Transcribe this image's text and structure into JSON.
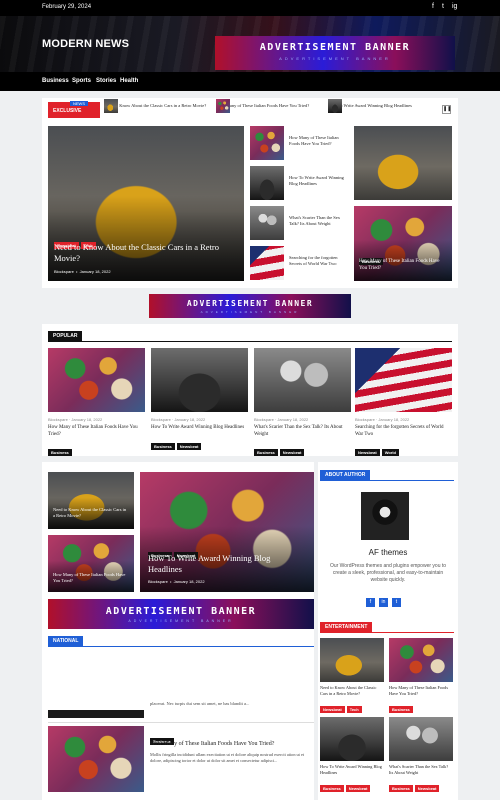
{
  "topbar": {
    "date": "February 29, 2024",
    "social": [
      "f",
      "t",
      "ig"
    ]
  },
  "header": {
    "logo": "MODERN NEWS",
    "ad_title": "ADVERTISEMENT BANNER",
    "ad_sub": "ADVERTISEMENT BANNER"
  },
  "nav": [
    "Business",
    "Sports",
    "Stories",
    "Health"
  ],
  "ticker": {
    "badge_top": "NEWS",
    "badge": "EXCLUSIVE",
    "items": [
      "Need to Know About the Classic Cars in a Retro Movie?",
      "How Many of These Italian Foods Have You Tried?",
      "How To Write Award Winning Blog Headlines"
    ]
  },
  "featured": {
    "tags": [
      "Newsbeat",
      "Tech"
    ],
    "title": "Need to Know About the Classic Cars in a Retro Movie?",
    "author": "Blockspare",
    "date": "January 18, 2022"
  },
  "side_list": [
    "How Many of These Italian Foods Have You Tried?",
    "How To Write Award Winning Blog Headlines",
    "What's Scarier Than the Sex Talk? Its About Weight",
    "Searching for the forgotten Secrets of World War Two"
  ],
  "right_card": {
    "tag": "Business",
    "title": "How Many of These Italian Foods Have You Tried?"
  },
  "ad_mid": {
    "title": "ADVERTISEMENT BANNER",
    "sub": "ADVERTISEMENT BANNER"
  },
  "popular": {
    "title": "POPULAR",
    "cards": [
      {
        "author": "Blockspare",
        "date": "January 18, 2022",
        "title": "How Many of These Italian Foods Have You Tried?",
        "tags": [
          "Business"
        ]
      },
      {
        "author": "Blockspare",
        "date": "January 18, 2022",
        "title": "How To Write Award Winning Blog Headlines",
        "tags": [
          "Business",
          "Newsbeat"
        ]
      },
      {
        "author": "Blockspare",
        "date": "January 18, 2022",
        "title": "What's Scarier Than the Sex Talk? Its About Weight",
        "tags": [
          "Business",
          "Newsbeat"
        ]
      },
      {
        "author": "Blockspare",
        "date": "January 18, 2022",
        "title": "Searching for the forgotten Secrets of World War Two",
        "tags": [
          "Newsbeat",
          "World"
        ]
      }
    ]
  },
  "grid": {
    "small1": "Need to Know About the Classic Cars in a Retro Movie?",
    "small2": "How Many of These Italian Foods Have You Tried?",
    "big": {
      "tags": [
        "Business",
        "Newsbeat"
      ],
      "title": "How To Write Award Winning Blog Headlines",
      "author": "Blockspare",
      "date": "January 18, 2022"
    }
  },
  "about": {
    "title": "ABOUT AUTHOR",
    "name": "AF themes",
    "text": "Our WordPress themes and plugins empower you to create a sleek, professional, and easy-to-maintain website quickly.",
    "buttons": [
      "f",
      "in",
      "t"
    ]
  },
  "ad_low": {
    "title": "ADVERTISEMENT BANNER",
    "sub": "ADVERTISEMENT BANNER"
  },
  "national": {
    "title": "NATIONAL",
    "excerpt1": "placerat. Nec turpis dui sem sit amet, ne bas blandit a...",
    "item_tag": "Business",
    "item_title": "How Many of These Italian Foods Have You Tried?",
    "excerpt2": "Mollis fringilla incididunt ullam execitation ut et dolore aliquip nostrud exercit ation ut et dolore, adipiscing tortor et dolor ut dolor sit amet et consectetur adipisci..."
  },
  "entertainment": {
    "title": "ENTERTAINMENT",
    "items": [
      {
        "title": "Need to Know About the Classic Cars in a Retro Movie?",
        "tags": [
          "Newsbeat",
          "Tech"
        ]
      },
      {
        "title": "How Many of These Italian Foods Have You Tried?",
        "tags": [
          "Business"
        ]
      },
      {
        "title": "How To Write Award Winning Blog Headlines",
        "tags": [
          "Business",
          "Newsbeat"
        ]
      },
      {
        "title": "What's Scarier Than the Sex Talk? Its About Weight",
        "tags": [
          "Business",
          "Newsbeat"
        ]
      }
    ]
  },
  "colors": {
    "accent": "#e0222a",
    "blue": "#1f5fd6",
    "dark": "#000000"
  }
}
